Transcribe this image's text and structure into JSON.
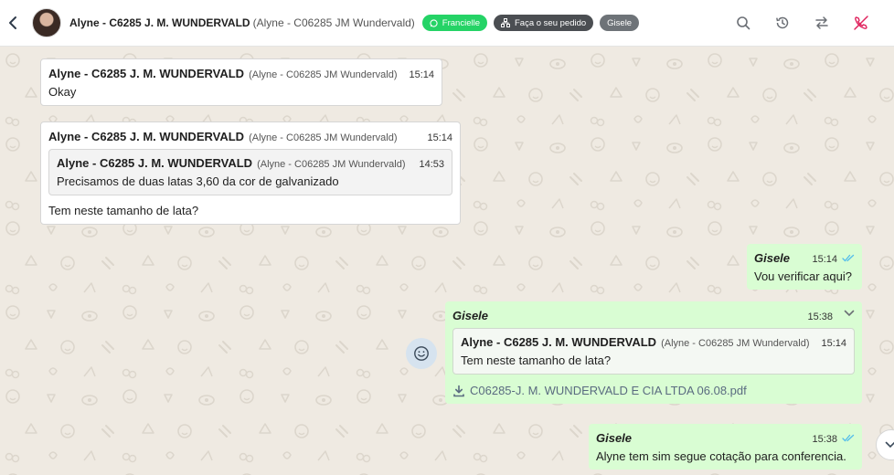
{
  "header": {
    "contact_name": "Alyne - C6285 J. M. WUNDERVALD",
    "contact_sub": "(Alyne - C06285 JM Wundervald)",
    "tags": [
      "Francielle",
      "Faça o seu pedido",
      "Gisele"
    ],
    "icons": [
      "back-arrow-icon",
      "search-icon",
      "history-icon",
      "transfer-icon",
      "hang-up-icon"
    ]
  },
  "messages": [
    {
      "direction": "in",
      "sender": "Alyne - C6285 J. M. WUNDERVALD",
      "sender_sub": "(Alyne - C06285 JM Wundervald)",
      "time": "15:14",
      "text": "Okay"
    },
    {
      "direction": "in",
      "sender": "Alyne - C6285 J. M. WUNDERVALD",
      "sender_sub": "(Alyne - C06285 JM Wundervald)",
      "time": "15:14",
      "quote": {
        "sender": "Alyne - C6285 J. M. WUNDERVALD",
        "sender_sub": "(Alyne - C06285 JM Wundervald)",
        "time": "14:53",
        "text": "Precisamos de duas latas 3,60 da cor de galvanizado"
      },
      "text": "Tem neste tamanho de lata?"
    },
    {
      "direction": "out",
      "agent": "Gisele",
      "time": "15:14",
      "text": "Vou verificar aqui?"
    },
    {
      "direction": "out",
      "agent": "Gisele",
      "time": "15:38",
      "quote": {
        "sender": "Alyne - C6285 J. M. WUNDERVALD",
        "sender_sub": "(Alyne - C06285 JM Wundervald)",
        "time": "15:14",
        "text": "Tem neste tamanho de lata?"
      },
      "file": "C06285-J. M. WUNDERVALD E CIA LTDA 06.08.pdf"
    },
    {
      "direction": "out",
      "agent": "Gisele",
      "time": "15:38",
      "text": "Alyne tem sim segue cotação para conferencia."
    }
  ],
  "colors": {
    "header_bg": "#ffffff",
    "chat_bg": "#efeae2",
    "incoming_bubble": "#ffffff",
    "outgoing_bubble": "#d9fdd3",
    "tag_green": "#25d366",
    "tag_dark": "#4b4e52",
    "tag_grey": "#6e7378",
    "read_ticks": "#53bdeb",
    "hang_up": "#e0245e"
  }
}
